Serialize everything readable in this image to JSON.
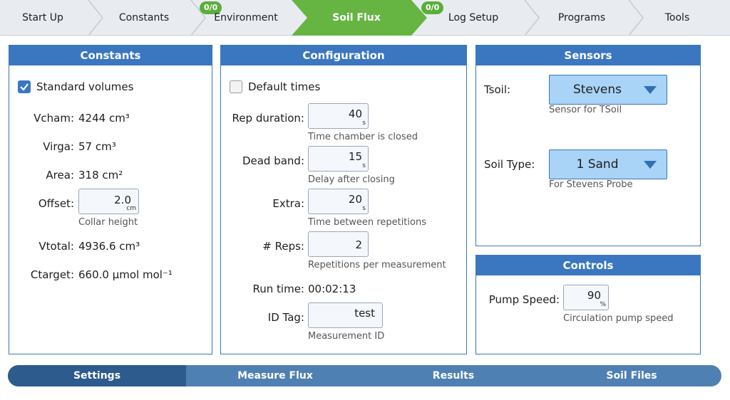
{
  "top_tabs": [
    {
      "label": "Start Up"
    },
    {
      "label": "Constants"
    },
    {
      "label": "Environment",
      "badge": "0/0"
    },
    {
      "label": "Soil Flux",
      "active": true
    },
    {
      "label": "Log Setup",
      "badge": "0/0"
    },
    {
      "label": "Programs"
    },
    {
      "label": "Tools"
    }
  ],
  "constants": {
    "title": "Constants",
    "standard_volumes": {
      "label": "Standard volumes",
      "checked": true
    },
    "vcham": {
      "label": "Vcham:",
      "value": "4244 cm³"
    },
    "virga": {
      "label": "Virga:",
      "value": "57 cm³"
    },
    "area": {
      "label": "Area:",
      "value": "318 cm²"
    },
    "offset": {
      "label": "Offset:",
      "value": "2.0",
      "unit": "cm",
      "hint": "Collar height"
    },
    "vtotal": {
      "label": "Vtotal:",
      "value": "4936.6 cm³"
    },
    "ctarget": {
      "label": "Ctarget:",
      "value": "660.0 µmol mol⁻¹"
    }
  },
  "configuration": {
    "title": "Configuration",
    "default_times": {
      "label": "Default times",
      "checked": false
    },
    "rep_duration": {
      "label": "Rep duration:",
      "value": "40",
      "unit": "s",
      "hint": "Time chamber is closed"
    },
    "dead_band": {
      "label": "Dead band:",
      "value": "15",
      "unit": "s",
      "hint": "Delay after closing"
    },
    "extra": {
      "label": "Extra:",
      "value": "20",
      "unit": "s",
      "hint": "Time between repetitions"
    },
    "reps": {
      "label": "# Reps:",
      "value": "2",
      "hint": "Repetitions per measurement"
    },
    "run_time": {
      "label": "Run time:",
      "value": "00:02:13"
    },
    "id_tag": {
      "label": "ID Tag:",
      "value": "test",
      "hint": "Measurement ID"
    }
  },
  "sensors": {
    "title": "Sensors",
    "tsoil": {
      "label": "Tsoil:",
      "value": "Stevens",
      "hint": "Sensor for TSoil"
    },
    "soil_type": {
      "label": "Soil Type:",
      "value": "1 Sand",
      "hint": "For Stevens Probe"
    }
  },
  "controls": {
    "title": "Controls",
    "pump_speed": {
      "label": "Pump Speed:",
      "value": "90",
      "unit": "%",
      "hint": "Circulation pump speed"
    }
  },
  "bottom_tabs": [
    {
      "label": "Settings",
      "active": true
    },
    {
      "label": "Measure Flux"
    },
    {
      "label": "Results"
    },
    {
      "label": "Soil Files"
    }
  ],
  "colors": {
    "accent_green": "#66b543",
    "panel_blue": "#3a77c0",
    "dropdown_blue": "#a9d3f7",
    "bottom_active": "#2d5b8e"
  }
}
